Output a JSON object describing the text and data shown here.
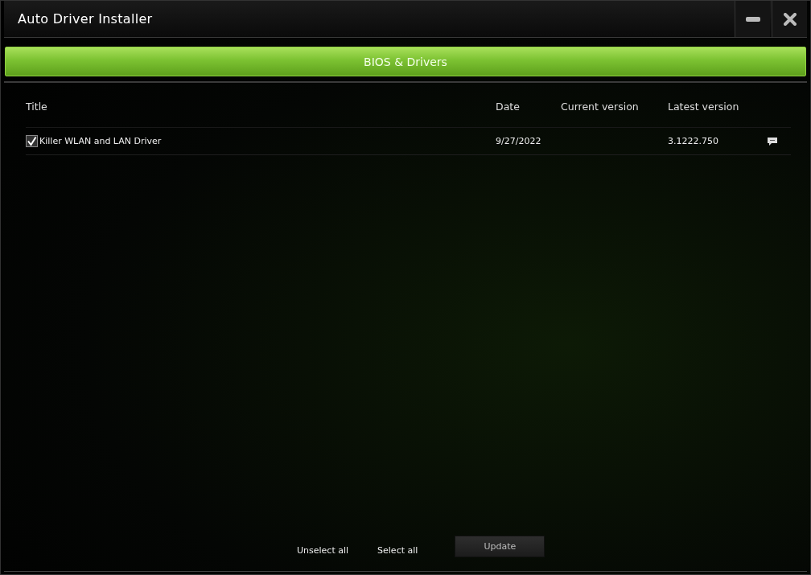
{
  "window": {
    "title": "Auto Driver Installer"
  },
  "tabs": [
    {
      "label": "BIOS & Drivers",
      "selected": true
    }
  ],
  "table": {
    "columns": [
      "Title",
      "Date",
      "Current version",
      "Latest version"
    ],
    "rows": [
      {
        "checked": true,
        "title": "Killer WLAN and LAN Driver",
        "date": "9/27/2022",
        "latest": "3.1222.750"
      }
    ]
  },
  "footer": {
    "links": [
      "Unselect all",
      "Select all"
    ],
    "button": "Update"
  }
}
